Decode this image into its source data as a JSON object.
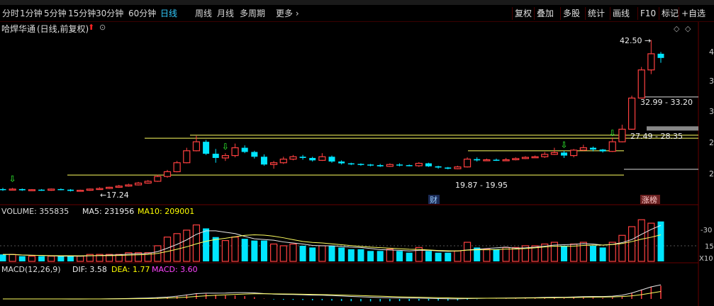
{
  "toolbar": {
    "periods": [
      "分时",
      "1分钟",
      "5分钟",
      "15分钟",
      "30分钟",
      "60分钟",
      "日线",
      "周线",
      "月线",
      "多周期",
      "更多"
    ],
    "active_period": "日线",
    "right_buttons": [
      "复权",
      "叠加",
      "多股",
      "统计",
      "画线",
      "F10",
      "标记",
      "+自选"
    ]
  },
  "chart_header": {
    "stock_name": "哈焊华通",
    "mode": "(日线,前复权)"
  },
  "price_axis": [
    "4",
    "3",
    "3",
    "2",
    "2",
    "2"
  ],
  "annotations": {
    "high": "42.50",
    "low": "17.24",
    "range1": "32.99 - 33.20",
    "range2": "27.49 - 28.35",
    "range3": "19.87 - 19.95",
    "tag_cai": "财",
    "tag_zhangbang": "涨榜"
  },
  "volume": {
    "header": "VOLUME: 355835",
    "ma5": "MA5: 231956",
    "ma10": "MA10: 209001",
    "axis_top": "-30",
    "axis_mid": "15",
    "axis_unit": "X10"
  },
  "macd": {
    "header": "MACD(12,26,9)",
    "dif": "DIF: 3.58",
    "dea": "DEA: 1.77",
    "macd": "MACD: 3.60"
  },
  "colors": {
    "up": "#ff4040",
    "down": "#00e5ff",
    "ma_white": "#e8e8e8",
    "ma_yellow": "#ffff60",
    "macd_purple": "#ff40ff",
    "active_tab": "#33ccff"
  },
  "chart_data": {
    "type": "candlestick",
    "candles": [
      [
        17.6,
        17.5,
        17.8,
        17.3
      ],
      [
        17.5,
        17.6,
        17.8,
        17.4
      ],
      [
        17.6,
        17.4,
        17.7,
        17.3
      ],
      [
        17.4,
        17.5,
        17.6,
        17.3
      ],
      [
        17.5,
        17.4,
        17.6,
        17.3
      ],
      [
        17.4,
        17.6,
        17.7,
        17.3
      ],
      [
        17.6,
        17.5,
        17.7,
        17.4
      ],
      [
        17.5,
        17.3,
        17.6,
        17.2
      ],
      [
        17.3,
        17.4,
        17.5,
        17.24
      ],
      [
        17.4,
        17.6,
        17.7,
        17.3
      ],
      [
        17.6,
        17.7,
        17.9,
        17.5
      ],
      [
        17.7,
        17.9,
        18.0,
        17.6
      ],
      [
        17.9,
        18.1,
        18.3,
        17.8
      ],
      [
        18.1,
        18.3,
        18.5,
        18.0
      ],
      [
        18.3,
        18.6,
        18.8,
        18.2
      ],
      [
        18.6,
        18.9,
        19.1,
        18.5
      ],
      [
        18.9,
        19.7,
        20.0,
        18.8
      ],
      [
        19.7,
        20.5,
        20.8,
        19.5
      ],
      [
        20.5,
        22.0,
        22.3,
        20.4
      ],
      [
        22.0,
        24.0,
        24.5,
        21.9
      ],
      [
        24.0,
        25.5,
        26.5,
        23.9
      ],
      [
        25.5,
        23.5,
        25.8,
        23.3
      ],
      [
        23.5,
        22.8,
        24.3,
        22.0
      ],
      [
        22.8,
        23.2,
        23.6,
        22.3
      ],
      [
        23.2,
        24.5,
        25.2,
        22.9
      ],
      [
        24.5,
        23.8,
        24.9,
        23.6
      ],
      [
        23.8,
        23.0,
        24.0,
        22.7
      ],
      [
        23.0,
        21.7,
        23.4,
        21.5
      ],
      [
        21.7,
        22.0,
        22.3,
        21.0
      ],
      [
        22.0,
        22.6,
        23.0,
        21.8
      ],
      [
        22.6,
        23.0,
        23.3,
        22.4
      ],
      [
        23.0,
        22.8,
        23.3,
        22.5
      ],
      [
        22.8,
        22.4,
        23.0,
        22.2
      ],
      [
        22.4,
        23.0,
        23.6,
        22.3
      ],
      [
        23.0,
        22.2,
        23.2,
        22.0
      ],
      [
        22.2,
        21.9,
        22.4,
        21.7
      ],
      [
        21.9,
        21.8,
        22.0,
        21.6
      ],
      [
        21.8,
        21.7,
        21.9,
        21.5
      ],
      [
        21.7,
        21.6,
        21.8,
        21.4
      ],
      [
        21.6,
        21.4,
        21.8,
        21.3
      ],
      [
        21.4,
        21.7,
        21.9,
        21.3
      ],
      [
        21.7,
        21.6,
        21.9,
        21.4
      ],
      [
        21.6,
        21.5,
        21.7,
        21.4
      ],
      [
        21.5,
        21.9,
        22.1,
        21.3
      ],
      [
        21.9,
        21.4,
        22.0,
        21.3
      ],
      [
        21.4,
        21.2,
        21.5,
        21.0
      ],
      [
        21.2,
        21.0,
        21.3,
        20.9
      ],
      [
        21.0,
        21.3,
        21.5,
        20.9
      ],
      [
        21.3,
        22.6,
        22.9,
        21.2
      ],
      [
        22.6,
        22.4,
        22.9,
        22.2
      ],
      [
        22.4,
        22.5,
        22.7,
        22.3
      ],
      [
        22.5,
        22.4,
        22.7,
        22.3
      ],
      [
        22.4,
        22.5,
        22.8,
        22.3
      ],
      [
        22.5,
        22.7,
        22.9,
        22.4
      ],
      [
        22.7,
        22.9,
        23.1,
        22.6
      ],
      [
        22.9,
        23.0,
        23.2,
        22.8
      ],
      [
        23.0,
        23.4,
        23.8,
        22.8
      ],
      [
        23.4,
        23.7,
        24.5,
        23.3
      ],
      [
        23.7,
        23.2,
        24.0,
        22.8
      ],
      [
        23.2,
        24.1,
        24.3,
        22.9
      ],
      [
        24.1,
        24.5,
        25.0,
        24.0
      ],
      [
        24.5,
        24.2,
        24.7,
        23.9
      ],
      [
        24.2,
        23.9,
        24.3,
        23.7
      ],
      [
        23.9,
        25.5,
        26.2,
        23.8
      ],
      [
        25.5,
        27.6,
        28.35,
        25.4
      ],
      [
        27.6,
        32.8,
        33.2,
        27.49
      ],
      [
        32.8,
        37.5,
        38.0,
        32.99
      ],
      [
        37.5,
        40.2,
        42.5,
        36.8
      ],
      [
        40.2,
        39.5,
        40.5,
        38.7
      ]
    ]
  }
}
